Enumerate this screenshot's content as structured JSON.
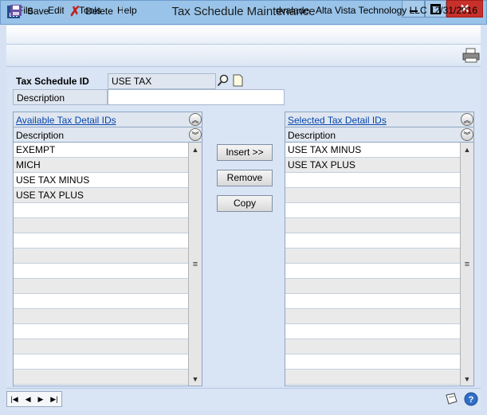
{
  "window": {
    "title": "Tax Schedule Maintenance"
  },
  "menu": {
    "items": [
      "File",
      "Edit",
      "Tools",
      "Help"
    ],
    "user": "dvalade",
    "company": "Alta Vista Technology LLC",
    "date": "12/31/2016"
  },
  "toolbar": {
    "save_label": "Save",
    "delete_label": "Delete"
  },
  "form": {
    "tax_schedule_id_label": "Tax Schedule ID",
    "tax_schedule_id_value": "USE TAX",
    "description_label": "Description",
    "description_value": ""
  },
  "available": {
    "title": "Available Tax Detail IDs",
    "column": "Description",
    "rows": [
      "EXEMPT",
      "MICH",
      "USE TAX MINUS",
      "USE TAX PLUS"
    ]
  },
  "selected": {
    "title": "Selected Tax Detail IDs",
    "column": "Description",
    "rows": [
      "USE TAX MINUS",
      "USE TAX PLUS"
    ]
  },
  "actions": {
    "insert": "Insert >>",
    "remove": "Remove",
    "copy": "Copy"
  },
  "colors": {
    "titlebar": "#99c3e8",
    "close": "#c7302b",
    "link": "#0645ad"
  }
}
